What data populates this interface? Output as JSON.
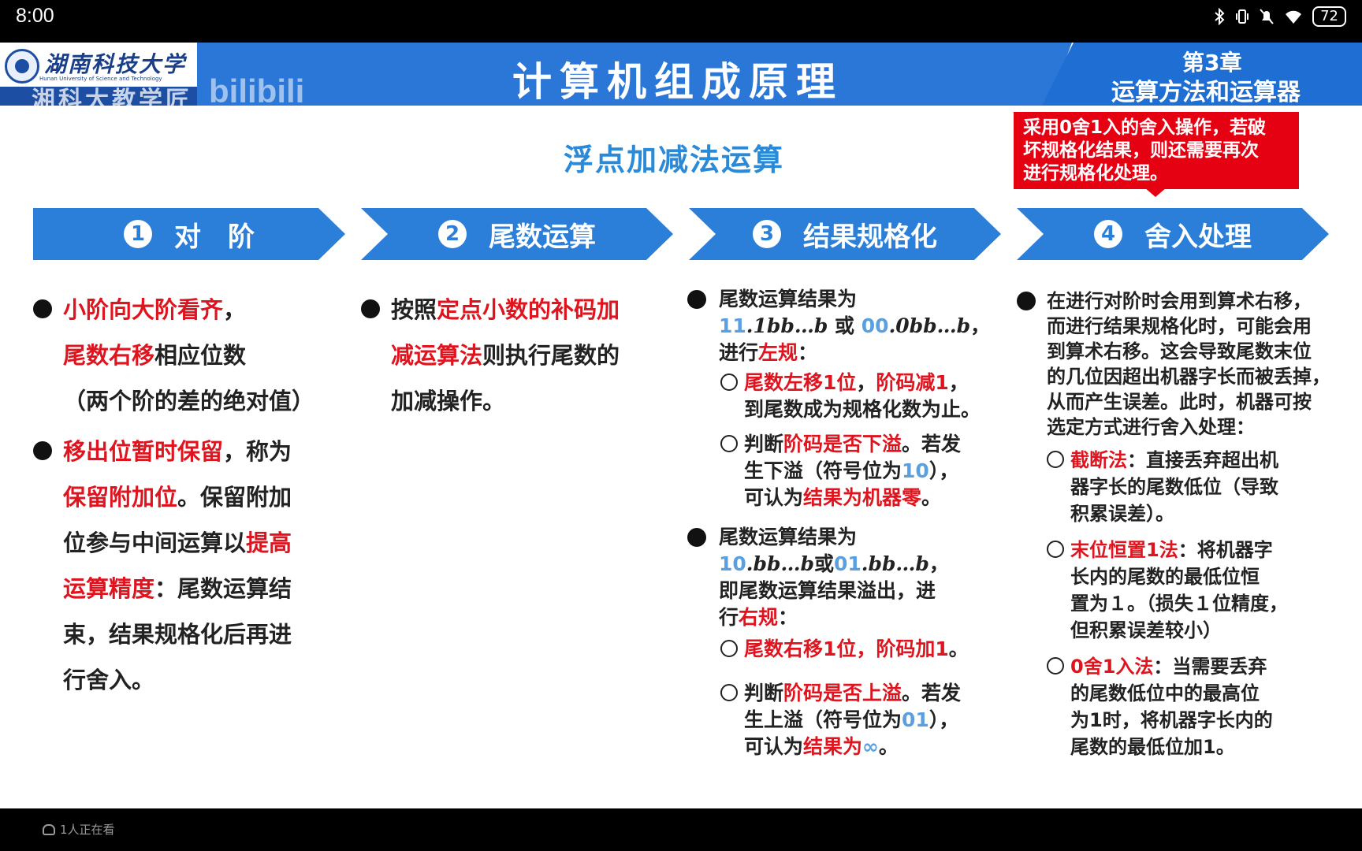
{
  "status_bar": {
    "time": "8:00",
    "icons": [
      "bluetooth-icon",
      "vibrate-icon",
      "mute-icon",
      "wifi-icon"
    ],
    "battery": "72"
  },
  "slide": {
    "logo": {
      "cn": "湖南科技大学",
      "en": "Hunan University of Science and Technology"
    },
    "watermark": "湘科大教学匠",
    "watermark_brand": "bilibili",
    "title": "计算机组成原理",
    "chapter_num": "第3章",
    "chapter_name": "运算方法和运算器",
    "subtitle": "浮点加减法运算",
    "note": [
      "采用0舍1入的舍入操作，若破",
      "坏规格化结果，则还需要再次",
      "进行规格化处理。"
    ],
    "steps": [
      {
        "num": "1",
        "label": "对　阶"
      },
      {
        "num": "2",
        "label": "尾数运算"
      },
      {
        "num": "3",
        "label": "结果规格化"
      },
      {
        "num": "4",
        "label": "舍入处理"
      }
    ],
    "col1": {
      "b1_l1_red": "小阶向大阶看齐",
      "b1_l1_tail": "，",
      "b1_l2_red": "尾数右移",
      "b1_l2_tail": "相应位数",
      "b1_l3": "（两个阶的差的绝对值）",
      "b2_l1_red": "移出位暂时保留",
      "b2_l1_tail": "，称为",
      "b2_l2_red": "保留附加位",
      "b2_l2_tail": "。保留附加",
      "b2_l3_head": "位参与中间运算以",
      "b2_l3_red": "提高",
      "b2_l4_red": "运算精度",
      "b2_l4_tail": "：尾数运算结",
      "b2_l5": "束，结果规格化后再进",
      "b2_l6": "行舍入。"
    },
    "col2": {
      "l1_head": "按照",
      "l1_red": "定点小数的补码加",
      "l2_red": "减运算法",
      "l2_tail": "则执行尾数的",
      "l3": "加减操作。"
    },
    "col3": {
      "a_l1": "尾数运算结果为",
      "a_l2_n1": "11",
      "a_l2_m1": ".1bb…b",
      "a_l2_or": " 或 ",
      "a_l2_n2": "00",
      "a_l2_m2": ".0bb…b",
      "a_l2_tail": "，",
      "a_l3_head": "进行",
      "a_l3_red": "左规",
      "a_l3_tail": "：",
      "a_s1_red1": "尾数左移1位",
      "a_s1_mid": "，",
      "a_s1_red2": "阶码减1",
      "a_s1_tail": "，",
      "a_s1_l2": "到尾数成为规格化数为止。",
      "a_s2_head": "判断",
      "a_s2_red": "阶码是否下溢",
      "a_s2_tail": "。若发",
      "a_s2_l2_head": "生下溢（符号位为",
      "a_s2_l2_blue": "10",
      "a_s2_l2_tail": "），",
      "a_s2_l3_head": "可认为",
      "a_s2_l3_red": "结果为机器零",
      "a_s2_l3_tail": "。",
      "b_l1": "尾数运算结果为",
      "b_l2_n1": "10",
      "b_l2_m1": ".bb…b",
      "b_l2_or": "或",
      "b_l2_n2": "01",
      "b_l2_m2": ".bb…b",
      "b_l2_tail": "，",
      "b_l3": "即尾数运算结果溢出，进",
      "b_l4_head": "行",
      "b_l4_red": "右规",
      "b_l4_tail": "：",
      "b_s1_red": "尾数右移1位，阶码加1",
      "b_s1_tail": "。",
      "b_s2_head": "判断",
      "b_s2_red": "阶码是否上溢",
      "b_s2_tail": "。若发",
      "b_s2_l2_head": "生上溢（符号位为",
      "b_s2_l2_blue": "01",
      "b_s2_l2_tail": "），",
      "b_s2_l3_head": "可认为",
      "b_s2_l3_red": "结果为",
      "b_s2_l3_blue": "∞",
      "b_s2_l3_tail": "。"
    },
    "col4": {
      "intro": [
        "在进行对阶时会用到算术右移，",
        "而进行结果规格化时，可能会用",
        "到算术右移。这会导致尾数末位",
        "的几位因超出机器字长而被丢掉，",
        "从而产生误差。此时，机器可按",
        "选定方式进行舍入处理："
      ],
      "o1_red": "截断法",
      "o1_tail": "：直接丢弃超出机",
      "o1_l2": "器字长的尾数低位（导致",
      "o1_l3": "积累误差）。",
      "o2_red": "末位恒置1法",
      "o2_tail": "：将机器字",
      "o2_l2": "长内的尾数的最低位恒",
      "o2_l3": "置为１。（损失１位精度，",
      "o2_l4": "但积累误差较小）",
      "o3_red": "0舍1入法",
      "o3_tail": "：当需要丢弃",
      "o3_l2": "的尾数低位中的最高位",
      "o3_l3": "为1时，将机器字长内的",
      "o3_l4": "尾数的最低位加1。"
    }
  },
  "bottom_bar": {
    "viewers": "1人正在看"
  }
}
